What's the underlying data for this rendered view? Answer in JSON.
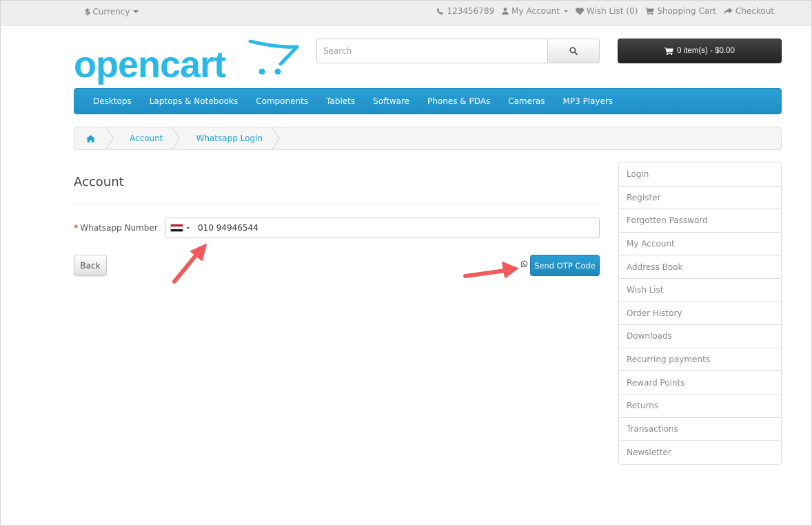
{
  "topbar": {
    "currency_symbol": "$",
    "currency_label": "Currency",
    "phone": "123456789",
    "my_account": "My Account",
    "wish_list": "Wish List (0)",
    "shopping_cart": "Shopping Cart",
    "checkout": "Checkout"
  },
  "header": {
    "logo_text": "opencart",
    "search_placeholder": "Search",
    "cart_label": "0 item(s) - $0.00"
  },
  "menu": {
    "items": [
      {
        "label": "Desktops"
      },
      {
        "label": "Laptops & Notebooks"
      },
      {
        "label": "Components"
      },
      {
        "label": "Tablets"
      },
      {
        "label": "Software"
      },
      {
        "label": "Phones & PDAs"
      },
      {
        "label": "Cameras"
      },
      {
        "label": "MP3 Players"
      }
    ]
  },
  "breadcrumb": {
    "items": [
      {
        "label": "Account"
      },
      {
        "label": "Whatsapp Login"
      }
    ]
  },
  "main": {
    "title": "Account",
    "field_required_mark": "*",
    "field_label": "Whatsapp Number",
    "phone_value": "010 94946544",
    "back_label": "Back",
    "otp_label": "Send OTP Code"
  },
  "colors": {
    "accent": "#229ac8",
    "required": "#d9534f",
    "annotation_arrow": "#f05a5a"
  },
  "sidebar": {
    "items": [
      {
        "label": "Login"
      },
      {
        "label": "Register"
      },
      {
        "label": "Forgotten Password"
      },
      {
        "label": "My Account"
      },
      {
        "label": "Address Book"
      },
      {
        "label": "Wish List"
      },
      {
        "label": "Order History"
      },
      {
        "label": "Downloads"
      },
      {
        "label": "Recurring payments"
      },
      {
        "label": "Reward Points"
      },
      {
        "label": "Returns"
      },
      {
        "label": "Transactions"
      },
      {
        "label": "Newsletter"
      }
    ]
  }
}
